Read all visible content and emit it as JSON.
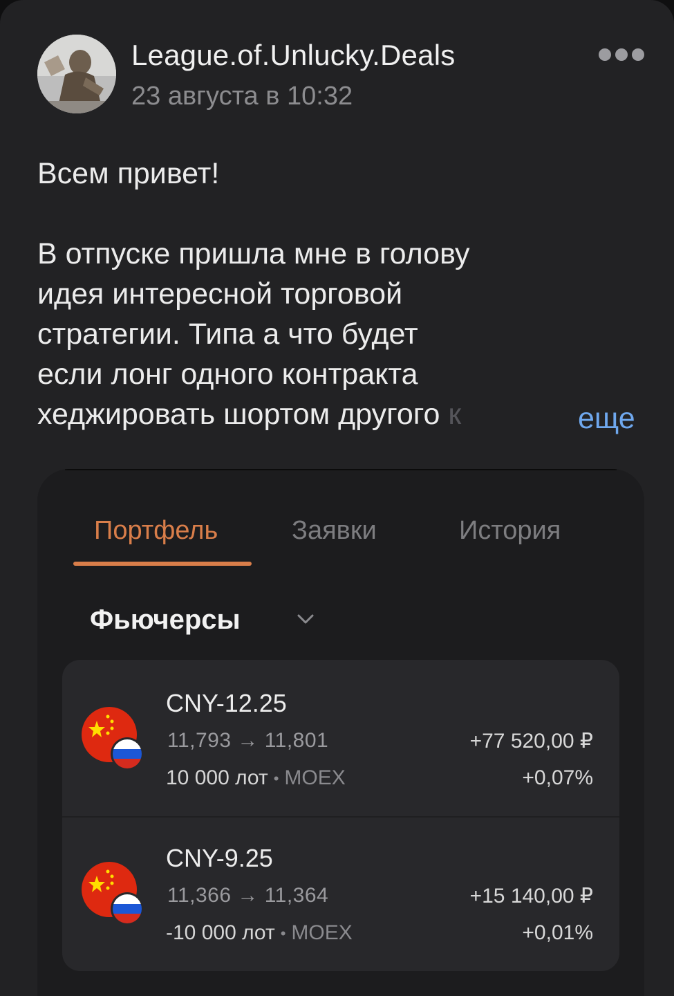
{
  "post": {
    "author": "League.of.Unlucky.Deals",
    "date": "23 августа в 10:32",
    "avatar_icon": "statue-photo-avatar",
    "more_icon": "three-dots-icon",
    "greeting": "Всем привет!",
    "lines": [
      "В отпуске пришла мне в голову",
      "идея интересной торговой",
      "стратегии. Типа а что будет",
      "если лонг одного контракта"
    ],
    "last_line": "хеджировать шортом другого",
    "last_line_fade": " к",
    "more_link": "еще"
  },
  "screenshot": {
    "tabs": [
      {
        "label": "Портфель",
        "active": true
      },
      {
        "label": "Заявки",
        "active": false
      },
      {
        "label": "История",
        "active": false
      }
    ],
    "section_title": "Фьючерсы",
    "positions": [
      {
        "ticker": "CNY-12.25",
        "price": "11,793 → 11,801",
        "lots": "10 000 лот",
        "exchange": "MOEX",
        "pnl": "+77 520,00 ₽",
        "pct": "+0,07%"
      },
      {
        "ticker": "CNY-9.25",
        "price": "11,366 → 11,364",
        "lots": "-10 000 лот",
        "exchange": "MOEX",
        "pnl": "+15 140,00 ₽",
        "pct": "+0,01%"
      }
    ],
    "dot_separator": "•"
  },
  "colors": {
    "accent_orange": "#d97e4a",
    "link_blue": "#6fa8ee",
    "background": "#222224"
  }
}
